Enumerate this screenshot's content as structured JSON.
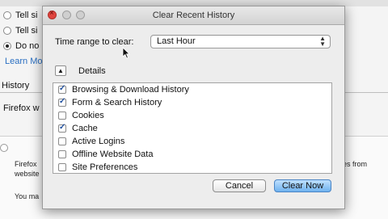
{
  "background": {
    "radio_options": [
      {
        "label": "Tell si",
        "checked": false
      },
      {
        "label": "Tell si",
        "checked": false
      },
      {
        "label": "Do no",
        "checked": true
      }
    ],
    "learn_more": "Learn Mo",
    "history_heading": "History",
    "firefox_line": "Firefox w",
    "lower_lines": [
      "Firefox",
      "website",
      "You ma"
    ],
    "lower_right_tail": "es from"
  },
  "dialog": {
    "title": "Clear Recent History",
    "time_range_label": "Time range to clear:",
    "time_range_value": "Last Hour",
    "details_label": "Details",
    "items": [
      {
        "label": "Browsing & Download History",
        "checked": true
      },
      {
        "label": "Form & Search History",
        "checked": true
      },
      {
        "label": "Cookies",
        "checked": false
      },
      {
        "label": "Cache",
        "checked": true
      },
      {
        "label": "Active Logins",
        "checked": false
      },
      {
        "label": "Offline Website Data",
        "checked": false
      },
      {
        "label": "Site Preferences",
        "checked": false
      }
    ],
    "cancel_label": "Cancel",
    "clear_label": "Clear Now"
  }
}
